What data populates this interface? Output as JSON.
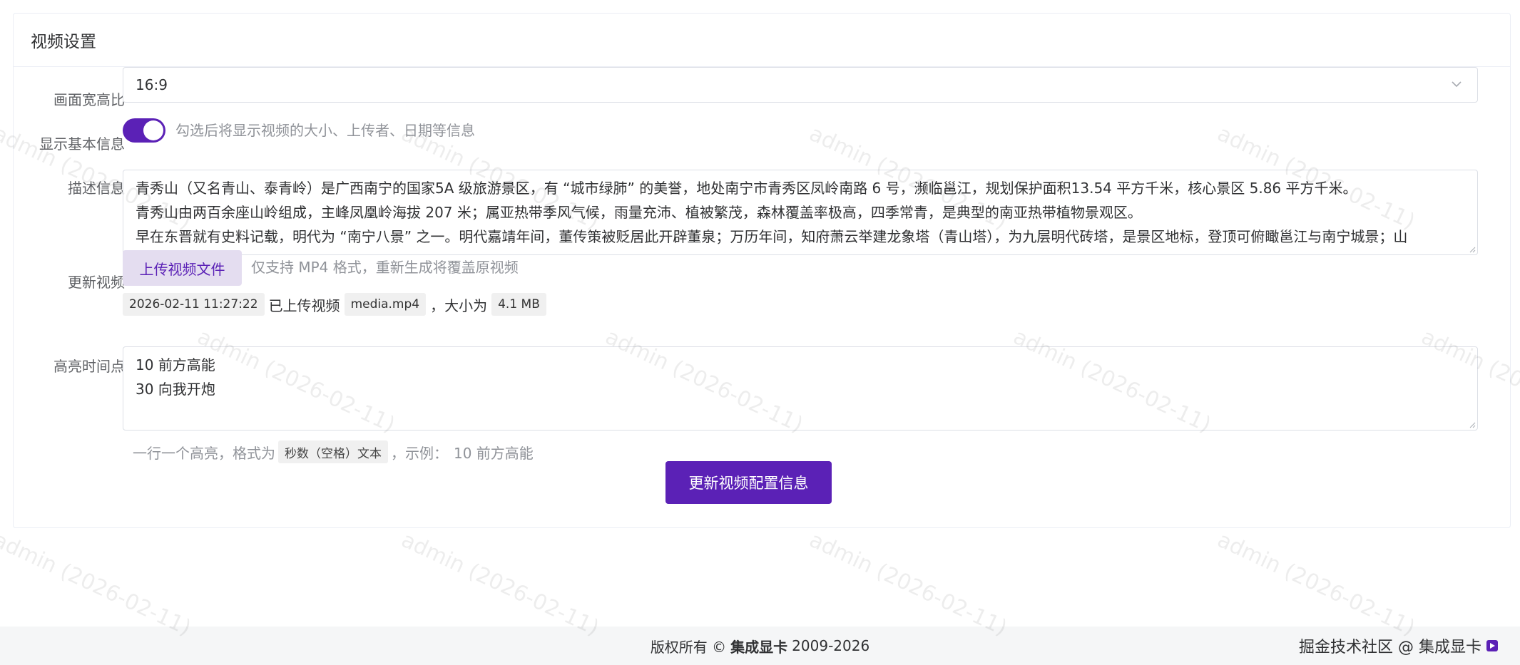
{
  "card": {
    "title": "视频设置"
  },
  "aspect": {
    "label": "画面宽高比",
    "value": "16:9"
  },
  "basic_info": {
    "label": "显示基本信息",
    "checked": true,
    "hint": "勾选后将显示视频的大小、上传者、日期等信息"
  },
  "description": {
    "label": "描述信息",
    "lines": [
      "青秀山（又名青山、泰青岭）是广西南宁的国家5A 级旅游景区，有 “城市绿肺” 的美誉，地处南宁市青秀区凤岭南路 6 号，濒临邕江，规划保护面积13.54 平方千米，核心景区 5.86 平方千米。",
      "青秀山由两百余座山岭组成，主峰凤凰岭海拔 207 米；属亚热带季风气候，雨量充沛、植被繁茂，森林覆盖率极高，四季常青，是典型的南亚热带植物景观区。",
      "早在东晋就有史料记载，明代为 “南宁八景” 之一。明代嘉靖年间，董传策被贬居此开辟董泉；万历年间，知府萧云举建龙象塔（青山塔），为九层明代砖塔，是景区地标，登顶可俯瞰邕江与南宁城景；山"
    ]
  },
  "update_video": {
    "label": "更新视频",
    "upload_button": "上传视频文件",
    "hint": "仅支持 MP4 格式，重新生成将覆盖原视频",
    "uploaded_at": "2026-02-11 11:27:22",
    "uploaded_text": "已上传视频",
    "filename": "media.mp4",
    "size_prefix": "，大小为",
    "size": "4.1 MB"
  },
  "highlights": {
    "label": "高亮时间点",
    "lines": [
      "10 前方高能",
      "30 向我开炮"
    ],
    "hint_prefix": "一行一个高亮，格式为",
    "hint_format": "秒数（空格）文本",
    "hint_example_prefix": "，示例：",
    "hint_example": "10 前方高能"
  },
  "submit": {
    "label": "更新视频配置信息"
  },
  "footer": {
    "copyright_prefix": "版权所有 ©",
    "brand": "集成显卡",
    "years": "2009-2026"
  },
  "corner_watermark": {
    "text": "掘金技术社区 @ 集成显卡"
  },
  "watermark": {
    "text": "admin (2026-02-11)"
  },
  "colors": {
    "primary": "#5b21b6",
    "primary_light": "#e4ddf0"
  }
}
